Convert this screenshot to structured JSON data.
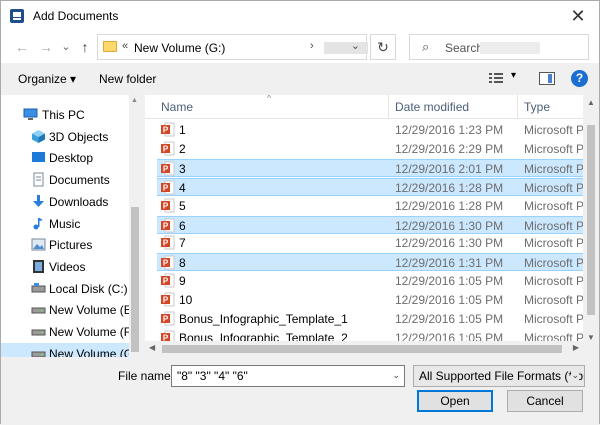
{
  "window": {
    "title": "Add Documents",
    "close_glyph": "✕"
  },
  "nav": {
    "back_glyph": "←",
    "forward_glyph": "→",
    "recent_glyph": "⌄",
    "up_glyph": "↑",
    "crumb_prefix": "«",
    "crumb": "New Volume (G:)",
    "crumb_arrow": "›",
    "addr_dropdown_glyph": "⌄",
    "refresh_glyph": "↻",
    "search_placeholder": "Search"
  },
  "toolbar": {
    "organize_label": "Organize ▾",
    "new_folder_label": "New folder",
    "view_dropdown_glyph": "▾",
    "help_glyph": "?"
  },
  "sidebar": {
    "items": [
      {
        "label": "This PC",
        "icon": "computer-icon"
      },
      {
        "label": "3D Objects",
        "icon": "cube-icon"
      },
      {
        "label": "Desktop",
        "icon": "desktop-icon"
      },
      {
        "label": "Documents",
        "icon": "document-icon"
      },
      {
        "label": "Downloads",
        "icon": "download-icon"
      },
      {
        "label": "Music",
        "icon": "music-icon"
      },
      {
        "label": "Pictures",
        "icon": "picture-icon"
      },
      {
        "label": "Videos",
        "icon": "video-icon"
      },
      {
        "label": "Local Disk (C:)",
        "icon": "disk-icon"
      },
      {
        "label": "New Volume (E:)",
        "icon": "drive-icon"
      },
      {
        "label": "New Volume (F:)",
        "icon": "drive-icon"
      },
      {
        "label": "New Volume (G:)",
        "icon": "drive-icon"
      }
    ],
    "selected_index": 11
  },
  "files": {
    "columns": {
      "name": "Name",
      "date": "Date modified",
      "type": "Type",
      "sort_glyph": "^"
    },
    "rows": [
      {
        "name": "1",
        "date": "12/29/2016 1:23 PM",
        "type": "Microsoft Po",
        "selected": false
      },
      {
        "name": "2",
        "date": "12/29/2016 2:29 PM",
        "type": "Microsoft Po",
        "selected": false
      },
      {
        "name": "3",
        "date": "12/29/2016 2:01 PM",
        "type": "Microsoft Po",
        "selected": true
      },
      {
        "name": "4",
        "date": "12/29/2016 1:28 PM",
        "type": "Microsoft Po",
        "selected": true
      },
      {
        "name": "5",
        "date": "12/29/2016 1:28 PM",
        "type": "Microsoft Po",
        "selected": false
      },
      {
        "name": "6",
        "date": "12/29/2016 1:30 PM",
        "type": "Microsoft Po",
        "selected": true
      },
      {
        "name": "7",
        "date": "12/29/2016 1:30 PM",
        "type": "Microsoft Po",
        "selected": false
      },
      {
        "name": "8",
        "date": "12/29/2016 1:31 PM",
        "type": "Microsoft Po",
        "selected": true
      },
      {
        "name": "9",
        "date": "12/29/2016 1:05 PM",
        "type": "Microsoft Po",
        "selected": false
      },
      {
        "name": "10",
        "date": "12/29/2016 1:05 PM",
        "type": "Microsoft Po",
        "selected": false
      },
      {
        "name": "Bonus_Infographic_Template_1",
        "date": "12/29/2016 1:05 PM",
        "type": "Microsoft Po",
        "selected": false
      },
      {
        "name": "Bonus_Infographic_Template_2",
        "date": "12/29/2016 1:05 PM",
        "type": "Microsoft Po",
        "selected": false
      }
    ]
  },
  "scroll": {
    "up_glyph": "▲",
    "down_glyph": "▼",
    "left_glyph": "◀",
    "right_glyph": "▶"
  },
  "footer": {
    "filename_label": "File name:",
    "filename_value": "\"8\" \"3\" \"4\" \"6\"",
    "filename_dropdown_glyph": "⌄",
    "format_value": "All Supported File Formats (*.br",
    "format_dropdown_glyph": "⌄",
    "open_label": "Open",
    "cancel_label": "Cancel"
  },
  "colors": {
    "selection": "#cce8ff",
    "selection_border": "#99d1ff",
    "accent": "#0078d7",
    "powerpoint": "#d24726"
  }
}
